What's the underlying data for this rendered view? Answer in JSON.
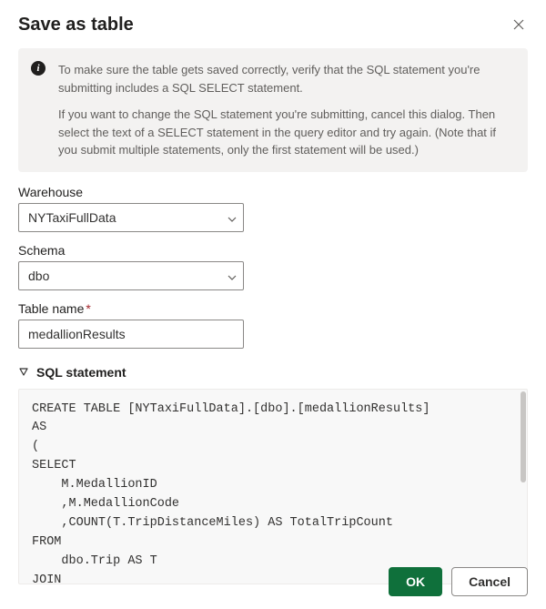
{
  "dialog": {
    "title": "Save as table",
    "info": {
      "line1": "To make sure the table gets saved correctly, verify that the SQL statement you're submitting includes a SQL SELECT statement.",
      "line2": "If you want to change the SQL statement you're submitting, cancel this dialog. Then select the text of a SELECT statement in the query editor and try again. (Note that if you submit multiple statements, only the first statement will be used.)"
    }
  },
  "fields": {
    "warehouse": {
      "label": "Warehouse",
      "value": "NYTaxiFullData"
    },
    "schema": {
      "label": "Schema",
      "value": "dbo"
    },
    "tablename": {
      "label": "Table name",
      "value": "medallionResults"
    }
  },
  "sql": {
    "label": "SQL statement",
    "content": "CREATE TABLE [NYTaxiFullData].[dbo].[medallionResults]\nAS\n(\nSELECT\n    M.MedallionID\n    ,M.MedallionCode\n    ,COUNT(T.TripDistanceMiles) AS TotalTripCount\nFROM\n    dbo.Trip AS T\nJOIN"
  },
  "buttons": {
    "ok": "OK",
    "cancel": "Cancel"
  }
}
